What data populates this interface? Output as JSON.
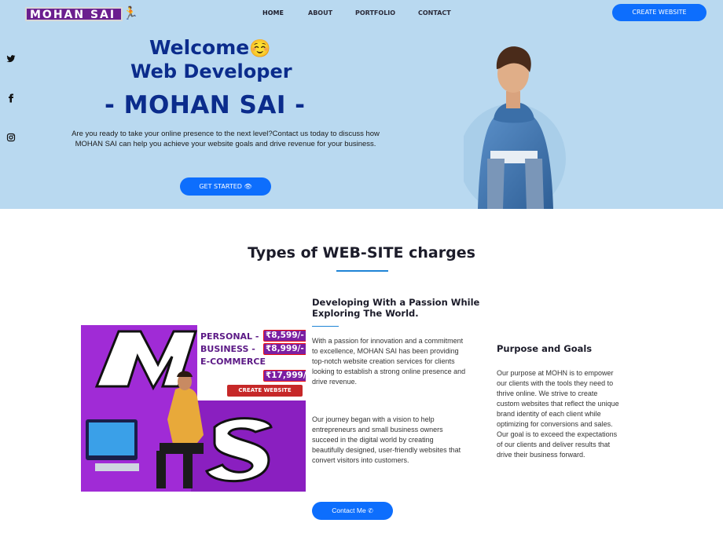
{
  "brand": {
    "logo_text": "MOHAN SAI"
  },
  "nav": {
    "home": "HOME",
    "about": "ABOUT",
    "portfolio": "PORTFOLIO",
    "contact": "CONTACT"
  },
  "header": {
    "cta_label": "CREATE WEBSITE"
  },
  "social": [
    {
      "icon": "twitter-icon"
    },
    {
      "icon": "facebook-icon"
    },
    {
      "icon": "instagram-icon"
    }
  ],
  "hero": {
    "welcome": "Welcome",
    "welcome_emoji": "☺️",
    "role": "Web Developer",
    "name": "- MOHAN SAI -",
    "description": "Are you ready to take your online presence to the next level?Contact us today to discuss how MOHAN SAI can help you achieve your website goals and drive revenue for your business.",
    "cta_label": "GET STARTED",
    "cta_icon": "eye-icon"
  },
  "section": {
    "title": "Types of WEB-SITE charges"
  },
  "promo": {
    "big_letter_1": "M",
    "big_letter_2": "S",
    "rows": [
      {
        "label": "PERSONAL -",
        "price": "₹8,599/-"
      },
      {
        "label": "BUSINESS -",
        "price": "₹8,999/-"
      },
      {
        "label": "E-COMMERCE",
        "price": "₹17,999/-"
      }
    ],
    "button_label": "CREATE WEBSITE"
  },
  "about": {
    "title": "Developing With a Passion While Exploring The World.",
    "p1": "With a passion for innovation and a commitment to excellence, MOHAN SAI has been providing top-notch website creation services for clients looking to establish a strong online presence and drive revenue.",
    "p2": "Our journey began with a vision to help entrepreneurs and small business owners succeed in the digital world by creating beautifully designed, user-friendly websites that convert visitors into customers.",
    "cta_label": "Contact Me",
    "cta_icon": "whatsapp-icon"
  },
  "goals": {
    "title": "Purpose and Goals",
    "text": "Our purpose at MOHN is to empower our clients with the tools they need to thrive online. We strive to create custom websites that reflect the unique brand identity of each client while optimizing for conversions and sales. Our goal is to exceed the expectations of our clients and deliver results that drive their business forward."
  },
  "colors": {
    "hero_bg": "#b9d9f0",
    "accent": "#0d6efd",
    "heading": "#0b2c8c",
    "brand_purple": "#6b1f8f"
  }
}
